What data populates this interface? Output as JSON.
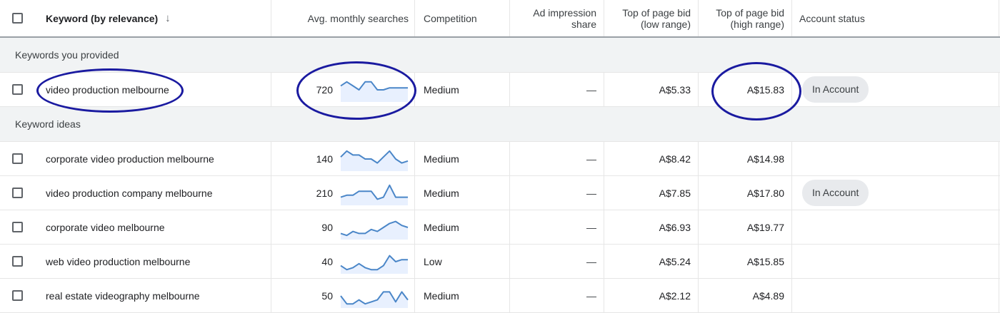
{
  "header": {
    "keyword": "Keyword (by relevance)",
    "sort_icon": "↓",
    "avg_searches": "Avg. monthly searches",
    "competition": "Competition",
    "ad_share_line1": "Ad impression",
    "ad_share_line2": "share",
    "bid_low_line1": "Top of page bid",
    "bid_low_line2": "(low range)",
    "bid_high_line1": "Top of page bid",
    "bid_high_line2": "(high range)",
    "account_status": "Account status"
  },
  "sections": {
    "provided": "Keywords you provided",
    "ideas": "Keyword ideas"
  },
  "provided_rows": [
    {
      "keyword": "video production melbourne",
      "searches": "720",
      "competition": "Medium",
      "ad_share": "—",
      "bid_low": "A$5.33",
      "bid_high": "A$15.83",
      "status": "In Account",
      "trend": [
        7,
        9,
        7,
        5,
        9,
        9,
        5,
        5,
        6,
        6,
        6,
        6
      ]
    }
  ],
  "idea_rows": [
    {
      "keyword": "corporate video production melbourne",
      "searches": "140",
      "competition": "Medium",
      "ad_share": "—",
      "bid_low": "A$8.42",
      "bid_high": "A$14.98",
      "status": "",
      "trend": [
        6,
        9,
        7,
        7,
        5,
        5,
        3,
        6,
        9,
        5,
        3,
        4
      ]
    },
    {
      "keyword": "video production company melbourne",
      "searches": "210",
      "competition": "Medium",
      "ad_share": "—",
      "bid_low": "A$7.85",
      "bid_high": "A$17.80",
      "status": "In Account",
      "trend": [
        3,
        4,
        4,
        6,
        6,
        6,
        2,
        3,
        9,
        3,
        3,
        3
      ]
    },
    {
      "keyword": "corporate video melbourne",
      "searches": "90",
      "competition": "Medium",
      "ad_share": "—",
      "bid_low": "A$6.93",
      "bid_high": "A$19.77",
      "status": "",
      "trend": [
        2,
        1,
        3,
        2,
        2,
        4,
        3,
        5,
        7,
        8,
        6,
        5
      ]
    },
    {
      "keyword": "web video production melbourne",
      "searches": "40",
      "competition": "Low",
      "ad_share": "—",
      "bid_low": "A$5.24",
      "bid_high": "A$15.85",
      "status": "",
      "trend": [
        3,
        1,
        2,
        4,
        2,
        1,
        1,
        3,
        8,
        5,
        6,
        6
      ]
    },
    {
      "keyword": "real estate videography melbourne",
      "searches": "50",
      "competition": "Medium",
      "ad_share": "—",
      "bid_low": "A$2.12",
      "bid_high": "A$4.89",
      "status": "",
      "trend": [
        5,
        1,
        1,
        3,
        1,
        2,
        3,
        7,
        7,
        2,
        7,
        3
      ]
    }
  ],
  "colors": {
    "sparkline": "#4a86c8",
    "sparkline_fill": "#e8f0fe",
    "annotation": "#1a1aa0"
  }
}
